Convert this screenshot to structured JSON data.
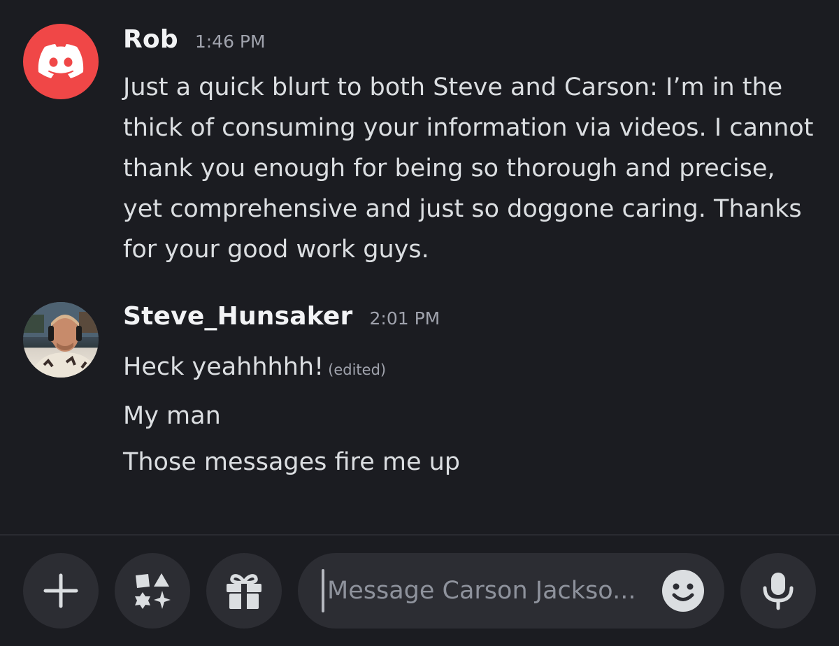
{
  "messages": [
    {
      "author": "Rob",
      "timestamp": "1:46 PM",
      "avatar_icon": "discord-logo-icon",
      "avatar_color": "#f04747",
      "text": "Just a quick blurt to both Steve and Carson: I’m in the thick of consuming your information via videos. I cannot thank you enough for being so thorough and precise, yet comprehensive and just so doggone caring. Thanks for your good work guys."
    },
    {
      "author": "Steve_Hunsaker",
      "timestamp": "2:01 PM",
      "avatar_icon": "user-photo-avatar",
      "lines": [
        {
          "text": "Heck yeahhhhh!",
          "edited": "(edited)"
        },
        {
          "text": "My man"
        },
        {
          "text": "Those messages fire me up"
        }
      ]
    }
  ],
  "composer": {
    "placeholder": "Message Carson Jackso...",
    "buttons": {
      "add": "plus-icon",
      "apps": "apps-shapes-icon",
      "gift": "gift-icon",
      "emoji": "emoji-face-icon",
      "voice": "microphone-icon"
    }
  },
  "colors": {
    "background": "#1b1c21",
    "control_background": "#2c2d33",
    "text": "#dbdee1",
    "muted": "#a0a3ad"
  }
}
